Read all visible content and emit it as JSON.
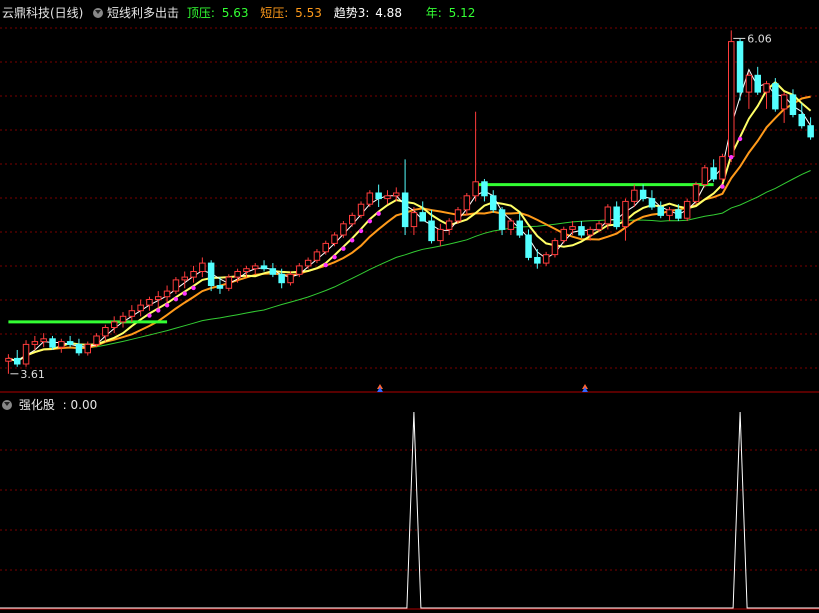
{
  "header": {
    "stock_title": "云鼎科技(日线)",
    "indicator_name": "短线利多出击",
    "top_press_label": "顶压:",
    "top_press_value": "5.63",
    "short_press_label": "短压:",
    "short_press_value": "5.53",
    "trend_label": "趋势3:",
    "trend_value": "4.88",
    "year_label": "年:",
    "year_value": "5.12"
  },
  "sub_header": {
    "indicator_label": "强化股",
    "value_text": ": 0.00"
  },
  "annotations": {
    "high_price": "6.06",
    "low_price": "3.61"
  },
  "colors": {
    "background": "#000000",
    "grid": "#7a0000",
    "candle_up": "#ff3c3c",
    "candle_down": "#54ffff",
    "ma_white": "#ffffff",
    "ma_yellow": "#ffff66",
    "ma_orange": "#ff9a1a",
    "ma_green": "#33cc33",
    "pressure_green": "#33ff33",
    "signal_dots": "#ff33ff",
    "header_green": "#33ff33",
    "header_orange": "#ff9a1a"
  },
  "chart_data": {
    "type": "candlestick",
    "ohlc": [
      [
        3.7,
        3.75,
        3.61,
        3.72
      ],
      [
        3.72,
        3.78,
        3.66,
        3.68
      ],
      [
        3.68,
        3.85,
        3.66,
        3.82
      ],
      [
        3.82,
        3.88,
        3.78,
        3.84
      ],
      [
        3.84,
        3.9,
        3.8,
        3.86
      ],
      [
        3.86,
        3.88,
        3.78,
        3.8
      ],
      [
        3.8,
        3.86,
        3.76,
        3.84
      ],
      [
        3.84,
        3.88,
        3.8,
        3.82
      ],
      [
        3.82,
        3.86,
        3.74,
        3.76
      ],
      [
        3.76,
        3.84,
        3.74,
        3.82
      ],
      [
        3.82,
        3.9,
        3.8,
        3.88
      ],
      [
        3.88,
        3.96,
        3.84,
        3.94
      ],
      [
        3.94,
        4.02,
        3.9,
        3.98
      ],
      [
        3.98,
        4.05,
        3.94,
        4.02
      ],
      [
        4.02,
        4.1,
        3.98,
        4.06
      ],
      [
        4.06,
        4.14,
        4.02,
        4.1
      ],
      [
        4.1,
        4.16,
        4.06,
        4.14
      ],
      [
        4.14,
        4.2,
        4.08,
        4.16
      ],
      [
        4.16,
        4.24,
        4.12,
        4.2
      ],
      [
        4.2,
        4.3,
        4.18,
        4.28
      ],
      [
        4.28,
        4.34,
        4.22,
        4.3
      ],
      [
        4.3,
        4.38,
        4.26,
        4.34
      ],
      [
        4.34,
        4.44,
        4.3,
        4.4
      ],
      [
        4.4,
        4.42,
        4.2,
        4.24
      ],
      [
        4.24,
        4.3,
        4.18,
        4.22
      ],
      [
        4.22,
        4.32,
        4.2,
        4.3
      ],
      [
        4.3,
        4.36,
        4.26,
        4.34
      ],
      [
        4.34,
        4.38,
        4.3,
        4.36
      ],
      [
        4.36,
        4.4,
        4.32,
        4.38
      ],
      [
        4.38,
        4.42,
        4.34,
        4.36
      ],
      [
        4.36,
        4.4,
        4.3,
        4.32
      ],
      [
        4.32,
        4.36,
        4.22,
        4.26
      ],
      [
        4.26,
        4.34,
        4.24,
        4.32
      ],
      [
        4.32,
        4.4,
        4.3,
        4.38
      ],
      [
        4.38,
        4.44,
        4.36,
        4.42
      ],
      [
        4.42,
        4.5,
        4.4,
        4.48
      ],
      [
        4.48,
        4.56,
        4.46,
        4.54
      ],
      [
        4.54,
        4.62,
        4.52,
        4.6
      ],
      [
        4.6,
        4.7,
        4.58,
        4.68
      ],
      [
        4.68,
        4.76,
        4.66,
        4.74
      ],
      [
        4.74,
        4.84,
        4.72,
        4.82
      ],
      [
        4.82,
        4.92,
        4.8,
        4.9
      ],
      [
        4.9,
        4.96,
        4.8,
        4.86
      ],
      [
        4.86,
        4.92,
        4.82,
        4.88
      ],
      [
        4.88,
        4.94,
        4.84,
        4.9
      ],
      [
        4.9,
        5.14,
        4.6,
        4.66
      ],
      [
        4.66,
        4.8,
        4.6,
        4.76
      ],
      [
        4.76,
        4.84,
        4.7,
        4.7
      ],
      [
        4.7,
        4.78,
        4.54,
        4.56
      ],
      [
        4.56,
        4.68,
        4.52,
        4.64
      ],
      [
        4.64,
        4.72,
        4.6,
        4.7
      ],
      [
        4.7,
        4.8,
        4.68,
        4.78
      ],
      [
        4.78,
        4.9,
        4.74,
        4.88
      ],
      [
        4.88,
        5.48,
        4.84,
        4.98
      ],
      [
        4.98,
        5.0,
        4.84,
        4.88
      ],
      [
        4.88,
        4.92,
        4.76,
        4.78
      ],
      [
        4.78,
        4.8,
        4.6,
        4.64
      ],
      [
        4.64,
        4.72,
        4.6,
        4.7
      ],
      [
        4.7,
        4.76,
        4.58,
        4.6
      ],
      [
        4.6,
        4.64,
        4.42,
        4.44
      ],
      [
        4.44,
        4.5,
        4.36,
        4.4
      ],
      [
        4.4,
        4.48,
        4.38,
        4.46
      ],
      [
        4.46,
        4.58,
        4.44,
        4.56
      ],
      [
        4.56,
        4.66,
        4.54,
        4.64
      ],
      [
        4.64,
        4.7,
        4.6,
        4.66
      ],
      [
        4.66,
        4.7,
        4.58,
        4.6
      ],
      [
        4.6,
        4.66,
        4.56,
        4.64
      ],
      [
        4.64,
        4.7,
        4.62,
        4.68
      ],
      [
        4.68,
        4.82,
        4.64,
        4.8
      ],
      [
        4.8,
        4.84,
        4.64,
        4.66
      ],
      [
        4.66,
        4.86,
        4.56,
        4.84
      ],
      [
        4.84,
        4.96,
        4.8,
        4.92
      ],
      [
        4.92,
        4.96,
        4.84,
        4.86
      ],
      [
        4.86,
        4.92,
        4.78,
        4.8
      ],
      [
        4.8,
        4.84,
        4.72,
        4.74
      ],
      [
        4.74,
        4.8,
        4.7,
        4.78
      ],
      [
        4.78,
        4.82,
        4.7,
        4.72
      ],
      [
        4.72,
        4.86,
        4.7,
        4.84
      ],
      [
        4.84,
        4.98,
        4.82,
        4.96
      ],
      [
        4.96,
        5.1,
        4.94,
        5.08
      ],
      [
        5.08,
        5.14,
        4.98,
        5.0
      ],
      [
        5.0,
        5.18,
        4.98,
        5.16
      ],
      [
        5.16,
        6.06,
        5.12,
        5.98
      ],
      [
        5.98,
        6.0,
        5.56,
        5.62
      ],
      [
        5.62,
        5.76,
        5.5,
        5.74
      ],
      [
        5.74,
        5.8,
        5.6,
        5.62
      ],
      [
        5.62,
        5.7,
        5.5,
        5.68
      ],
      [
        5.68,
        5.72,
        5.48,
        5.5
      ],
      [
        5.5,
        5.62,
        5.4,
        5.6
      ],
      [
        5.6,
        5.64,
        5.44,
        5.46
      ],
      [
        5.46,
        5.54,
        5.36,
        5.38
      ],
      [
        5.38,
        5.44,
        5.28,
        5.3
      ]
    ],
    "high_mark": 6.06,
    "low_mark": 3.61,
    "sub_indicator": {
      "name": "强化股",
      "spike_indices": [
        46,
        83
      ]
    }
  }
}
